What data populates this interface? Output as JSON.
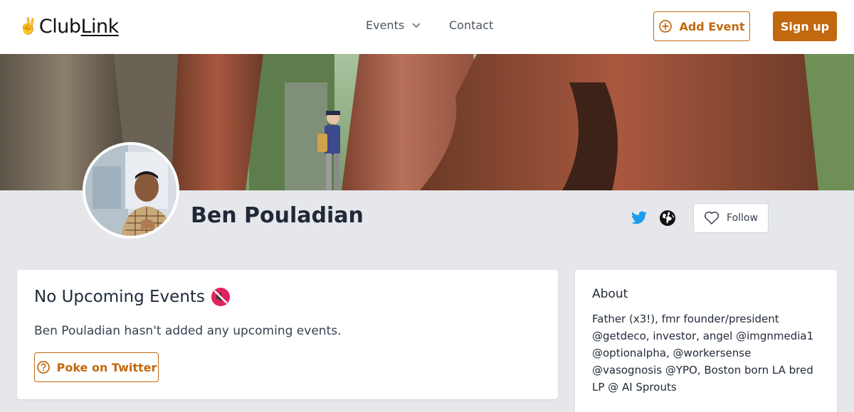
{
  "header": {
    "logo_prefix": "Club",
    "logo_suffix": "Link",
    "logo_icon": "victory-hand-icon",
    "nav": {
      "events_label": "Events",
      "contact_label": "Contact"
    },
    "add_event_label": "Add Event",
    "sign_up_label": "Sign up"
  },
  "profile": {
    "name": "Ben Pouladian",
    "follow_label": "Follow",
    "social_icons": [
      "twitter-icon",
      "globe-icon"
    ]
  },
  "events": {
    "title": "No Upcoming Events",
    "title_icon": "speaker-muted-icon",
    "message": "Ben Pouladian hasn't added any upcoming events.",
    "poke_label": "Poke on Twitter"
  },
  "about": {
    "title": "About",
    "text": "Father (x3!), fmr founder/president @getdeco, investor, angel @imgnmedia1 @optionalpha, @workersense @vasognosis @YPO, Boston born LA bred LP @ AI Sprouts"
  },
  "colors": {
    "accent": "#c2680f",
    "page_bg": "#e5e7eb",
    "twitter": "#1d9bf0"
  }
}
